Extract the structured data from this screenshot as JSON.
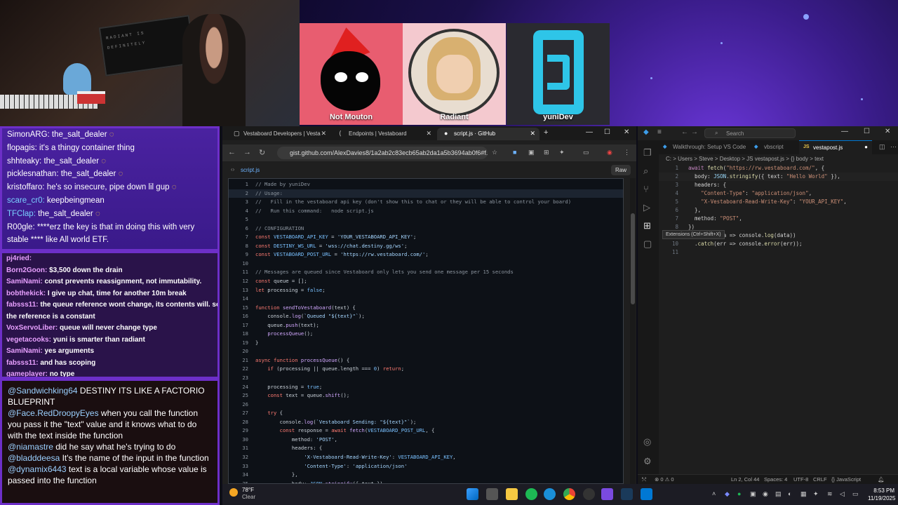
{
  "stream": {
    "camera_text": [
      "RADIANT IS DEFINITELY",
      "IN SLIPPERS BUT",
      "THROUGH WORK TOO"
    ],
    "participants": [
      {
        "name": "Not Mouton"
      },
      {
        "name": "Radiant"
      },
      {
        "name": "yuniDev"
      }
    ]
  },
  "chat_primary": [
    {
      "user": "SimonARG:",
      "text": "the_salt_dealer",
      "emote": "smile"
    },
    {
      "user": "flopagis:",
      "text": "it's a thingy container thing"
    },
    {
      "user": "shhteaky:",
      "text": "the_salt_dealer",
      "emote": "ring"
    },
    {
      "user": "picklesnathan:",
      "text": "the_salt_dealer",
      "emote": "ring"
    },
    {
      "user": "kristoffaro:",
      "text": "he's so insecure, pipe down lil gup",
      "emote": "smile"
    },
    {
      "user": "scare_cr0:",
      "text": "keepbeingmean",
      "user_color": "#7ad0ff"
    },
    {
      "user": "TFClap:",
      "text": "the_salt_dealer",
      "user_color": "#7ad0ff",
      "emote": "ring"
    },
    {
      "user": "R00gle:",
      "text": "****erz the key is that im doing this with very"
    },
    {
      "user": "",
      "text": "stable **** like All world ETF."
    }
  ],
  "chat_secondary": [
    {
      "user": "pj4ried:",
      "text": ""
    },
    {
      "user": "Born2Goon:",
      "text": "$3,500 down the drain"
    },
    {
      "user": "SamiNami:",
      "text": "const prevents reassignment, not immutability."
    },
    {
      "user": "bobthekick:",
      "text": "I give up chat, time for another 10m break"
    },
    {
      "user": "fabsss11:",
      "text": "the queue reference wont change, its contents will. so"
    },
    {
      "user": "",
      "text": "the reference is a constant"
    },
    {
      "user": "VoxServoLiber:",
      "text": "queue will never change type"
    },
    {
      "user": "vegetacooks:",
      "text": "yuni is smarter than radiant"
    },
    {
      "user": "SamiNami:",
      "text": "yes arguments"
    },
    {
      "user": "fabsss11:",
      "text": "and has scoping"
    },
    {
      "user": "gameplayer:",
      "text": "no type"
    }
  ],
  "chat_tertiary": [
    {
      "user": "@Sandwichking64",
      "text": "DESTINY ITS LIKE A FACTORIO BLUEPRINT"
    },
    {
      "user": "@Face.RedDroopyEyes",
      "text": "when you call the function you pass it the \"text\" value and it knows what to do with the text inside the function"
    },
    {
      "user": "@niamastre",
      "text": "did he say what he's trying to do"
    },
    {
      "user": "@bladddeesa",
      "text": "It's the name of the input in the function"
    },
    {
      "user": "@dynamix6443",
      "text": "text is a local variable whose value is passed into the function"
    }
  ],
  "browser": {
    "tabs": [
      {
        "label": "Vestaboard Developers | Vesta",
        "active": false
      },
      {
        "label": "Endpoints | Vestaboard",
        "active": false
      },
      {
        "label": "script.js · GitHub",
        "active": true
      }
    ],
    "new_tab": "+",
    "url": "gist.github.com/AlexDavies8/1a2ab2c83ecb65ab2da1a5b3694ab0f6#f...",
    "file_name": "script.js",
    "raw_label": "Raw",
    "code_lines": [
      "// Made by yuniDev",
      "// Usage:",
      "//   Fill in the vestaboard api key (don't show this to chat or they will be able to control your board)",
      "//   Run this command:   node script.js",
      "",
      "// CONFIGURATION",
      "const VESTABOARD_API_KEY = 'YOUR_VESTABOARD_API_KEY';",
      "const DESTINY_WS_URL = 'wss://chat.destiny.gg/ws';",
      "const VESTABOARD_POST_URL = 'https://rw.vestaboard.com/';",
      "",
      "// Messages are queued since Vestaboard only lets you send one message per 15 seconds",
      "const queue = [];",
      "let processing = false;",
      "",
      "function sendToVestaboard(text) {",
      "    console.log(`Queued \"${text}\"`);",
      "    queue.push(text);",
      "    processQueue();",
      "}",
      "",
      "async function processQueue() {",
      "    if (processing || queue.length === 0) return;",
      "",
      "    processing = true;",
      "    const text = queue.shift();",
      "",
      "    try {",
      "        console.log(`Vestaboard Sending: \"${text}\"`);",
      "        const response = await fetch(VESTABOARD_POST_URL, {",
      "            method: 'POST',",
      "            headers: {",
      "                'X-Vestaboard-Read-Write-Key': VESTABOARD_API_KEY,",
      "                'Content-Type': 'application/json'",
      "            },",
      "            body: JSON.stringify({ text })"
    ]
  },
  "vscode": {
    "search_placeholder": "Search",
    "tabs": [
      {
        "label": "Walkthrough: Setup VS Code",
        "active": false
      },
      {
        "label": "vbscript",
        "active": false
      },
      {
        "label": "vestapost.js",
        "active": true
      }
    ],
    "breadcrumb": "C: > Users > Steve > Desktop > JS vestapost.js > {} body > text",
    "code_lines": [
      "await fetch(\"https://rw.vestaboard.com/\", {",
      "  body: JSON.stringify({ text: \"Hello World\" }),",
      "  headers: {",
      "    \"Content-Type\": \"application/json\",",
      "    \"X-Vestaboard-Read-Write-Key\": \"YOUR_API_KEY\",",
      "  },",
      "  method: \"POST\",",
      "})",
      "  .then(data => console.log(data))",
      "  .catch(err => console.error(err));",
      ""
    ],
    "tooltip": "Extensions (Ctrl+Shift+X)",
    "status": {
      "errors": "⊗ 0 ⚠ 0",
      "cursor": "Ln 2, Col 44",
      "spaces": "Spaces: 4",
      "encoding": "UTF-8",
      "eol": "CRLF",
      "language": "{} JavaScript"
    }
  },
  "taskbar": {
    "weather_temp": "78°F",
    "weather_desc": "Clear",
    "time": "8:53 PM",
    "date": "11/19/2025"
  },
  "colors": {
    "chat_border": "#6d2fc8",
    "accent_blue": "#0078d4"
  }
}
